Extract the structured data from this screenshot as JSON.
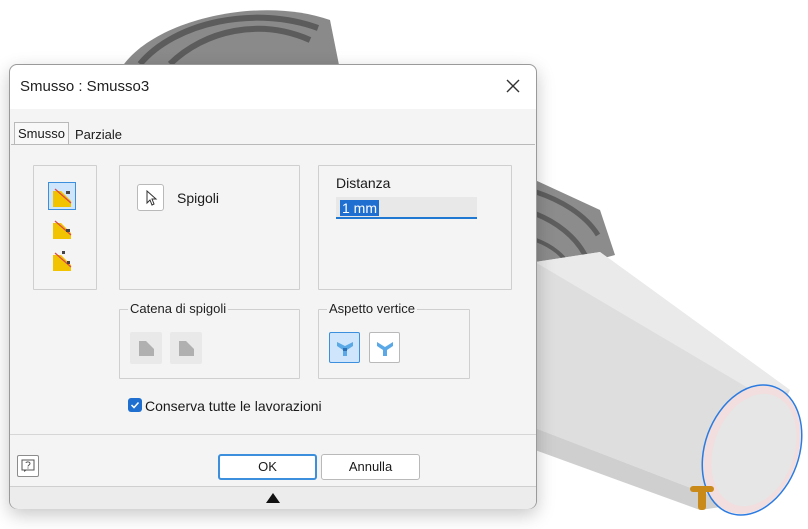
{
  "dialog": {
    "title": "Smusso : Smusso3",
    "tabs": [
      {
        "label": "Smusso",
        "active": true
      },
      {
        "label": "Parziale",
        "active": false
      }
    ],
    "edges": {
      "label": "Spigoli"
    },
    "distance": {
      "label": "Distanza",
      "value": "1 mm"
    },
    "edge_chain": {
      "label": "Catena di spigoli"
    },
    "corner_setback": {
      "label": "Aspetto vertice"
    },
    "preserve_features": {
      "label": "Conserva tutte le lavorazioni",
      "checked": true
    },
    "buttons": {
      "ok": "OK",
      "cancel": "Annulla"
    }
  },
  "colors": {
    "accent": "#1f6fd1",
    "selected_bg": "#cfe5fb",
    "edge_highlight": "#3b8fdc"
  },
  "icons": [
    "close-icon",
    "distance-chamfer-icon",
    "distance-angle-chamfer-icon",
    "two-distances-chamfer-icon",
    "cursor-arrow-icon",
    "chain-edges-icon",
    "single-edge-icon",
    "setback-corner-icon",
    "no-setback-corner-icon",
    "help-icon",
    "expand-arrow-icon"
  ]
}
